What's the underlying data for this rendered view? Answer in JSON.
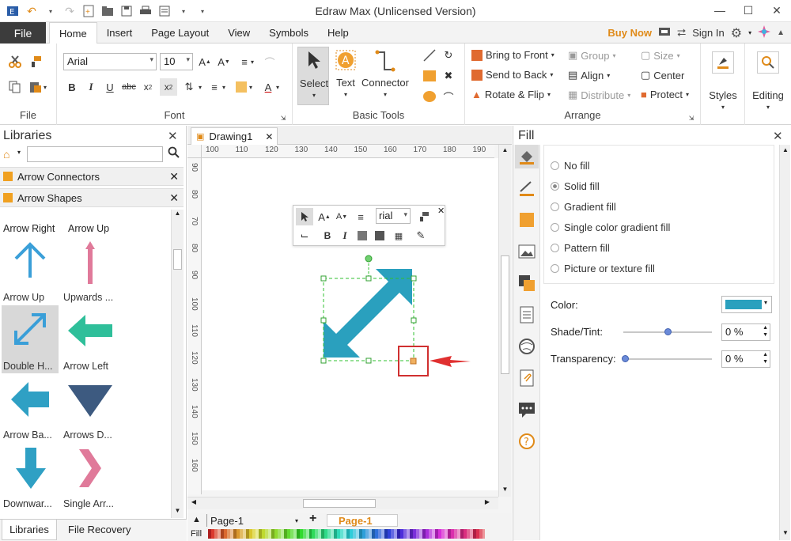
{
  "window": {
    "title": "Edraw Max (Unlicensed Version)"
  },
  "menu": {
    "file": "File",
    "tabs": [
      "Home",
      "Insert",
      "Page Layout",
      "View",
      "Symbols",
      "Help"
    ],
    "buy_now": "Buy Now",
    "sign_in": "Sign In"
  },
  "ribbon": {
    "file_group": "File",
    "font_group": "Font",
    "font_name": "Arial",
    "font_size": "10",
    "basic_tools_group": "Basic Tools",
    "select": "Select",
    "text": "Text",
    "connector": "Connector",
    "arrange_group": "Arrange",
    "bring_to_front": "Bring to Front",
    "send_to_back": "Send to Back",
    "rotate_flip": "Rotate & Flip",
    "group": "Group",
    "align": "Align",
    "distribute": "Distribute",
    "size": "Size",
    "center": "Center",
    "protect": "Protect",
    "styles": "Styles",
    "editing": "Editing"
  },
  "libraries": {
    "title": "Libraries",
    "sections": [
      "Arrow Connectors",
      "Arrow Shapes"
    ],
    "top_labels": [
      "Arrow Right",
      "Arrow Up"
    ],
    "shapes": [
      {
        "label": "Arrow Up",
        "color": "#3a9fd8"
      },
      {
        "label": "Upwards ...",
        "color": "#e07a9a"
      },
      {
        "label": "Double H...",
        "color": "#3a9fd8"
      },
      {
        "label": "Arrow Left",
        "color": "#2fbf9a"
      },
      {
        "label": "Arrow Ba...",
        "color": "#2fa0c4"
      },
      {
        "label": "Arrows D...",
        "color": "#3d5a80"
      },
      {
        "label": "Downwar...",
        "color": "#2fa0c4"
      },
      {
        "label": "Single Arr...",
        "color": "#e07a9a"
      }
    ],
    "bottom_tabs": [
      "Libraries",
      "File Recovery"
    ]
  },
  "document": {
    "tab": "Drawing1",
    "ruler_h": [
      "100",
      "110",
      "120",
      "130",
      "140",
      "150",
      "160",
      "170",
      "180",
      "190"
    ],
    "ruler_v": [
      "90",
      "80",
      "70",
      "80",
      "90",
      "100",
      "110",
      "120",
      "130",
      "140",
      "150",
      "160"
    ],
    "mini_font": "rial",
    "page_tab": "Page-1",
    "page_label": "Page-1",
    "fill_label": "Fill",
    "shape_color": "#2aa0be"
  },
  "fill_panel": {
    "title": "Fill",
    "options": [
      "No fill",
      "Solid fill",
      "Gradient fill",
      "Single color gradient fill",
      "Pattern fill",
      "Picture or texture fill"
    ],
    "selected": "Solid fill",
    "color_label": "Color:",
    "color_value": "#2aa0be",
    "shade_label": "Shade/Tint:",
    "shade_value": "0 %",
    "shade_level": 0.5,
    "transparency_label": "Transparency:",
    "transparency_value": "0 %",
    "transparency_level": 0
  }
}
